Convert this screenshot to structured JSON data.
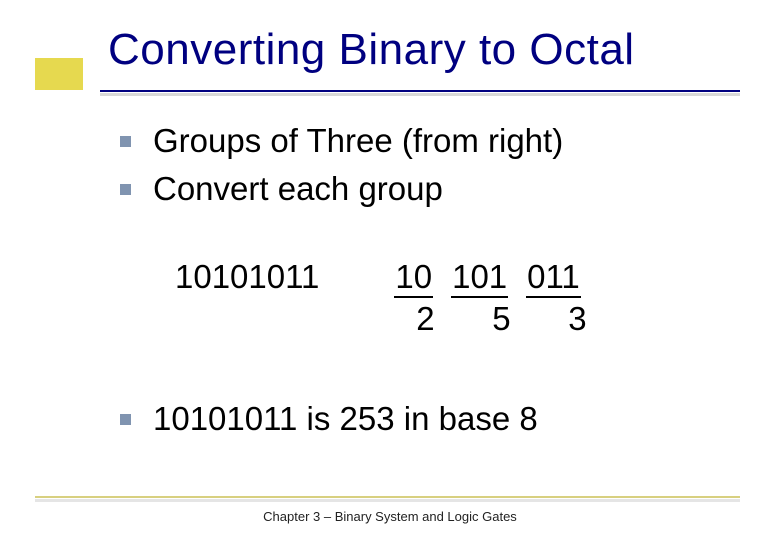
{
  "slide": {
    "title": "Converting Binary to Octal",
    "bullets": [
      "Groups of Three (from right)",
      "Convert each group"
    ],
    "example": {
      "binary": "10101011",
      "groups": [
        "10",
        "101",
        "011"
      ],
      "digits": [
        "2",
        "5",
        "3"
      ]
    },
    "conclusion": "10101011 is 253 in base 8",
    "footer": "Chapter 3 – Binary  System and Logic Gates"
  }
}
